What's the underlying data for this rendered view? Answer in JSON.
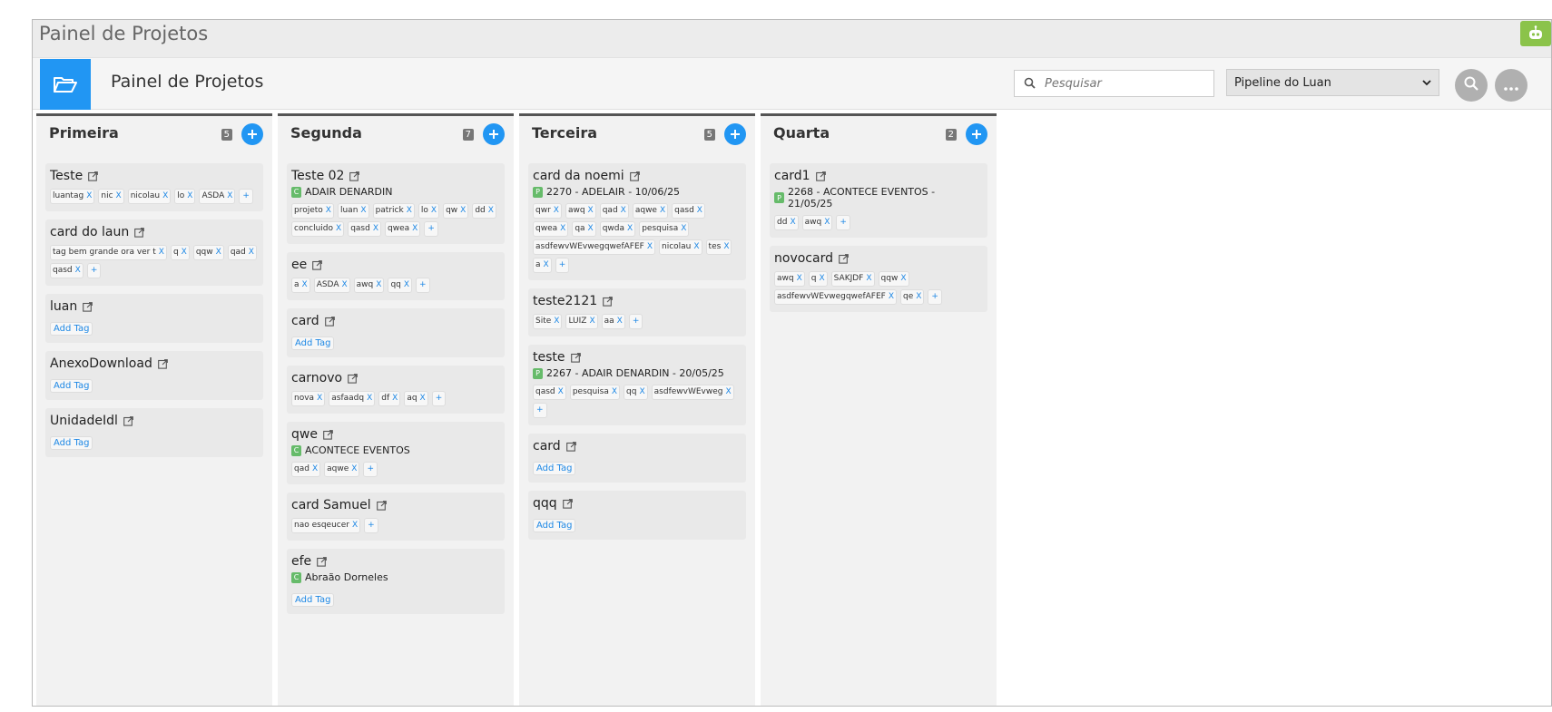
{
  "window": {
    "title": "Painel de Projetos"
  },
  "header": {
    "title": "Painel de Projetos",
    "search_placeholder": "Pesquisar",
    "pipeline_selected": "Pipeline do Luan"
  },
  "icons": {
    "bot": "bot-icon",
    "folder": "folder-open-icon",
    "search": "search-icon",
    "more": "more-dots-icon",
    "add": "plus-icon",
    "external": "external-link-icon"
  },
  "colors": {
    "accent": "#2196f3",
    "bot": "#8bc34a",
    "badge": "#66bb6a"
  },
  "columns": [
    {
      "title": "Primeira",
      "count": "5",
      "cards": [
        {
          "title": "Teste",
          "tags": [
            "luantag",
            "nic",
            "nicolau",
            "lo",
            "ASDA"
          ]
        },
        {
          "title": "card do laun",
          "tags": [
            "tag bem grande ora ver t",
            "q",
            "qqw",
            "qad",
            "qasd"
          ]
        },
        {
          "title": "luan",
          "add_tag": "Add Tag"
        },
        {
          "title": "AnexoDownload",
          "add_tag": "Add Tag"
        },
        {
          "title": "UnidadeIdl",
          "add_tag": "Add Tag"
        }
      ]
    },
    {
      "title": "Segunda",
      "count": "7",
      "cards": [
        {
          "title": "Teste 02",
          "badge": "C",
          "client": "ADAIR DENARDIN",
          "tags": [
            "projeto",
            "luan",
            "patrick",
            "lo",
            "qw",
            "dd",
            "concluido",
            "qasd",
            "qwea"
          ]
        },
        {
          "title": "ee",
          "tags": [
            "a",
            "ASDA",
            "awq",
            "qq"
          ]
        },
        {
          "title": "card",
          "add_tag": "Add Tag"
        },
        {
          "title": "carnovo",
          "tags": [
            "nova",
            "asfaadq",
            "df",
            "aq"
          ]
        },
        {
          "title": "qwe",
          "badge": "C",
          "client": "ACONTECE EVENTOS",
          "tags": [
            "qad",
            "aqwe"
          ]
        },
        {
          "title": "card Samuel",
          "tags": [
            "nao esqeucer"
          ]
        },
        {
          "title": "efe",
          "badge": "C",
          "client": "Abraão Dorneles",
          "add_tag": "Add Tag"
        }
      ]
    },
    {
      "title": "Terceira",
      "count": "5",
      "cards": [
        {
          "title": "card da noemi",
          "badge": "P",
          "client": "2270 - ADELAIR - 10/06/25",
          "tags": [
            "qwr",
            "awq",
            "qad",
            "aqwe",
            "qasd",
            "qwea",
            "qa",
            "qwda",
            "pesquisa",
            "asdfewvWEvwegqwefAFEF",
            "nicolau",
            "tes",
            "a"
          ]
        },
        {
          "title": "teste2121",
          "tags": [
            "Site",
            "LUIZ",
            "aa"
          ]
        },
        {
          "title": "teste",
          "badge": "P",
          "client": "2267 - ADAIR DENARDIN - 20/05/25",
          "tags": [
            "qasd",
            "pesquisa",
            "qq",
            "asdfewvWEvweg"
          ]
        },
        {
          "title": "card",
          "add_tag": "Add Tag"
        },
        {
          "title": "qqq",
          "add_tag": "Add Tag"
        }
      ]
    },
    {
      "title": "Quarta",
      "count": "2",
      "cards": [
        {
          "title": "card1",
          "badge": "P",
          "client": "2268 - ACONTECE EVENTOS - 21/05/25",
          "tags": [
            "dd",
            "awq"
          ]
        },
        {
          "title": "novocard",
          "tags": [
            "awq",
            "q",
            "SAKJDF",
            "qqw",
            "asdfewvWEvwegqwefAFEF",
            "qe"
          ]
        }
      ]
    }
  ],
  "tag_remove": "X",
  "tag_add": "+"
}
